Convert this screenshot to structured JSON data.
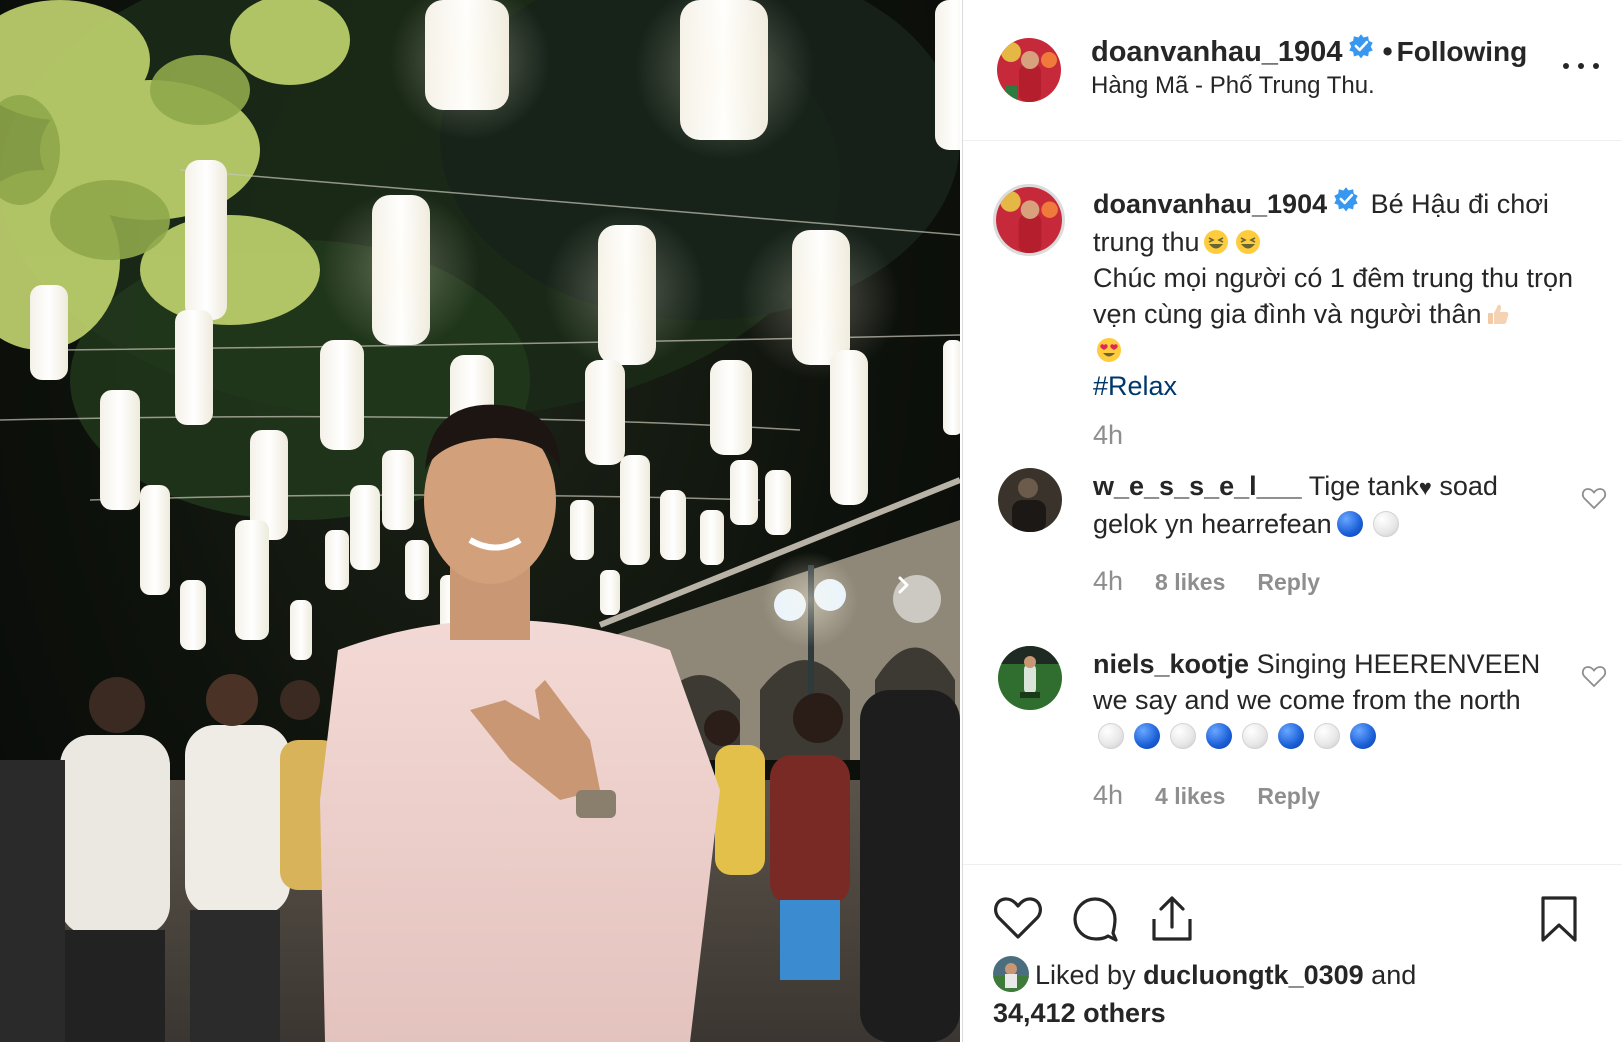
{
  "header": {
    "username": "doanvanhau_1904",
    "separator": "•",
    "follow_status": "Following",
    "location": "Hàng Mã - Phố Trung Thu."
  },
  "caption": {
    "username": "doanvanhau_1904",
    "line1": "Bé Hậu đi chơi trung thu",
    "line2": "Chúc mọi người có 1 đêm trung thu trọn vẹn cùng gia đình và người thân",
    "hashtag": "#Relax",
    "time": "4h"
  },
  "comments": [
    {
      "username": "w_e_s_s_e_l___",
      "text_part1": "Tige tank",
      "text_part2": "soad gelok yn hearrefean",
      "emoji_dots": [
        "blue",
        "white"
      ],
      "time": "4h",
      "likes": "8 likes",
      "reply": "Reply"
    },
    {
      "username": "niels_kootje",
      "text": "Singing HEERENVEEN we say and we come from the north",
      "emoji_dots": [
        "white",
        "blue",
        "white",
        "blue",
        "white",
        "blue",
        "white",
        "blue"
      ],
      "time": "4h",
      "likes": "4 likes",
      "reply": "Reply"
    }
  ],
  "likes": {
    "prefix": "Liked by",
    "user": "ducluongtk_0309",
    "conj": "and",
    "others": "34,412 others"
  },
  "icons": {
    "verified": "verified-badge-icon",
    "more": "more-options-icon",
    "like": "heart-icon",
    "comment": "comment-icon",
    "share": "share-icon",
    "save": "bookmark-icon",
    "next": "chevron-right-icon"
  },
  "colors": {
    "verified_blue": "#3897f0",
    "hashtag": "#00376b",
    "muted": "#8e8e8e",
    "text": "#262626"
  }
}
